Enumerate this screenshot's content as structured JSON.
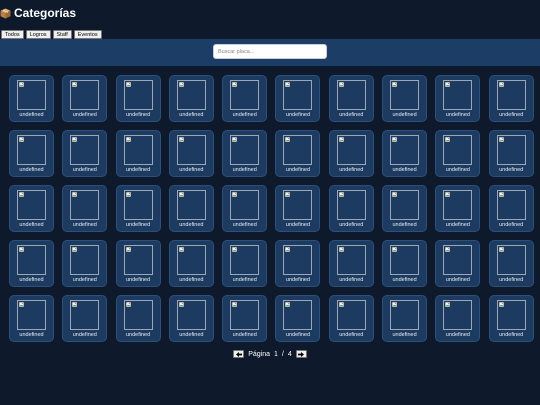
{
  "header": {
    "title": "Categorías",
    "icon": "package-icon"
  },
  "tabs": [
    {
      "label": "Todos"
    },
    {
      "label": "Logros"
    },
    {
      "label": "Staff"
    },
    {
      "label": "Eventos"
    }
  ],
  "search": {
    "placeholder": "Buscar placa...",
    "value": ""
  },
  "items": [
    {
      "label": "undefined"
    },
    {
      "label": "undefined"
    },
    {
      "label": "undefined"
    },
    {
      "label": "undefined"
    },
    {
      "label": "undefined"
    },
    {
      "label": "undefined"
    },
    {
      "label": "undefined"
    },
    {
      "label": "undefined"
    },
    {
      "label": "undefined"
    },
    {
      "label": "undefined"
    },
    {
      "label": "undefined"
    },
    {
      "label": "undefined"
    },
    {
      "label": "undefined"
    },
    {
      "label": "undefined"
    },
    {
      "label": "undefined"
    },
    {
      "label": "undefined"
    },
    {
      "label": "undefined"
    },
    {
      "label": "undefined"
    },
    {
      "label": "undefined"
    },
    {
      "label": "undefined"
    },
    {
      "label": "undefined"
    },
    {
      "label": "undefined"
    },
    {
      "label": "undefined"
    },
    {
      "label": "undefined"
    },
    {
      "label": "undefined"
    },
    {
      "label": "undefined"
    },
    {
      "label": "undefined"
    },
    {
      "label": "undefined"
    },
    {
      "label": "undefined"
    },
    {
      "label": "undefined"
    },
    {
      "label": "undefined"
    },
    {
      "label": "undefined"
    },
    {
      "label": "undefined"
    },
    {
      "label": "undefined"
    },
    {
      "label": "undefined"
    },
    {
      "label": "undefined"
    },
    {
      "label": "undefined"
    },
    {
      "label": "undefined"
    },
    {
      "label": "undefined"
    },
    {
      "label": "undefined"
    },
    {
      "label": "undefined"
    },
    {
      "label": "undefined"
    },
    {
      "label": "undefined"
    },
    {
      "label": "undefined"
    },
    {
      "label": "undefined"
    },
    {
      "label": "undefined"
    },
    {
      "label": "undefined"
    },
    {
      "label": "undefined"
    },
    {
      "label": "undefined"
    },
    {
      "label": "undefined"
    }
  ],
  "pagination": {
    "page_label": "Página",
    "current": "1",
    "separator": "/",
    "total": "4",
    "prev_icon": "arrow-left-icon",
    "next_icon": "arrow-right-icon"
  },
  "colors": {
    "background": "#0e1a2b",
    "search_bar": "#1c3d66",
    "card": "#1d3a61",
    "card_border": "#2c4f7c"
  }
}
